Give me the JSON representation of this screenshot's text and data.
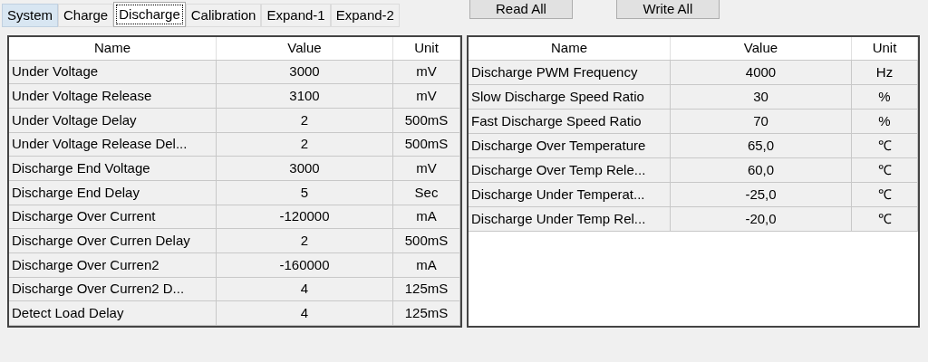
{
  "tabs": [
    {
      "label": "System",
      "selected": false,
      "hovered": true
    },
    {
      "label": "Charge",
      "selected": false,
      "hovered": false
    },
    {
      "label": "Discharge",
      "selected": true,
      "hovered": false
    },
    {
      "label": "Calibration",
      "selected": false,
      "hovered": false
    },
    {
      "label": "Expand-1",
      "selected": false,
      "hovered": false
    },
    {
      "label": "Expand-2",
      "selected": false,
      "hovered": false
    }
  ],
  "buttons": [
    "Read All",
    "Write All"
  ],
  "tables": [
    {
      "columns": [
        "Name",
        "Value",
        "Unit"
      ],
      "rows": [
        [
          "Under Voltage",
          "3000",
          "mV"
        ],
        [
          "Under Voltage Release",
          "3100",
          "mV"
        ],
        [
          "Under Voltage Delay",
          "2",
          "500mS"
        ],
        [
          "Under Voltage Release Del...",
          "2",
          "500mS"
        ],
        [
          "Discharge End Voltage",
          "3000",
          "mV"
        ],
        [
          "Discharge End Delay",
          "5",
          "Sec"
        ],
        [
          "Discharge Over Current",
          "-120000",
          "mA"
        ],
        [
          "Discharge Over Curren Delay",
          "2",
          "500mS"
        ],
        [
          "Discharge Over Curren2",
          "-160000",
          "mA"
        ],
        [
          "Discharge Over Curren2 D...",
          "4",
          "125mS"
        ],
        [
          "Detect Load Delay",
          "4",
          "125mS"
        ]
      ]
    },
    {
      "columns": [
        "Name",
        "Value",
        "Unit"
      ],
      "rows": [
        [
          "Discharge PWM Frequency",
          "4000",
          "Hz"
        ],
        [
          "Slow Discharge Speed Ratio",
          "30",
          "%"
        ],
        [
          "Fast Discharge Speed Ratio",
          "70",
          "%"
        ],
        [
          "Discharge Over Temperature",
          "65,0",
          "℃"
        ],
        [
          "Discharge Over Temp Rele...",
          "60,0",
          "℃"
        ],
        [
          "Discharge Under Temperat...",
          "-25,0",
          "℃"
        ],
        [
          "Discharge Under Temp Rel...",
          "-20,0",
          "℃"
        ]
      ]
    }
  ]
}
